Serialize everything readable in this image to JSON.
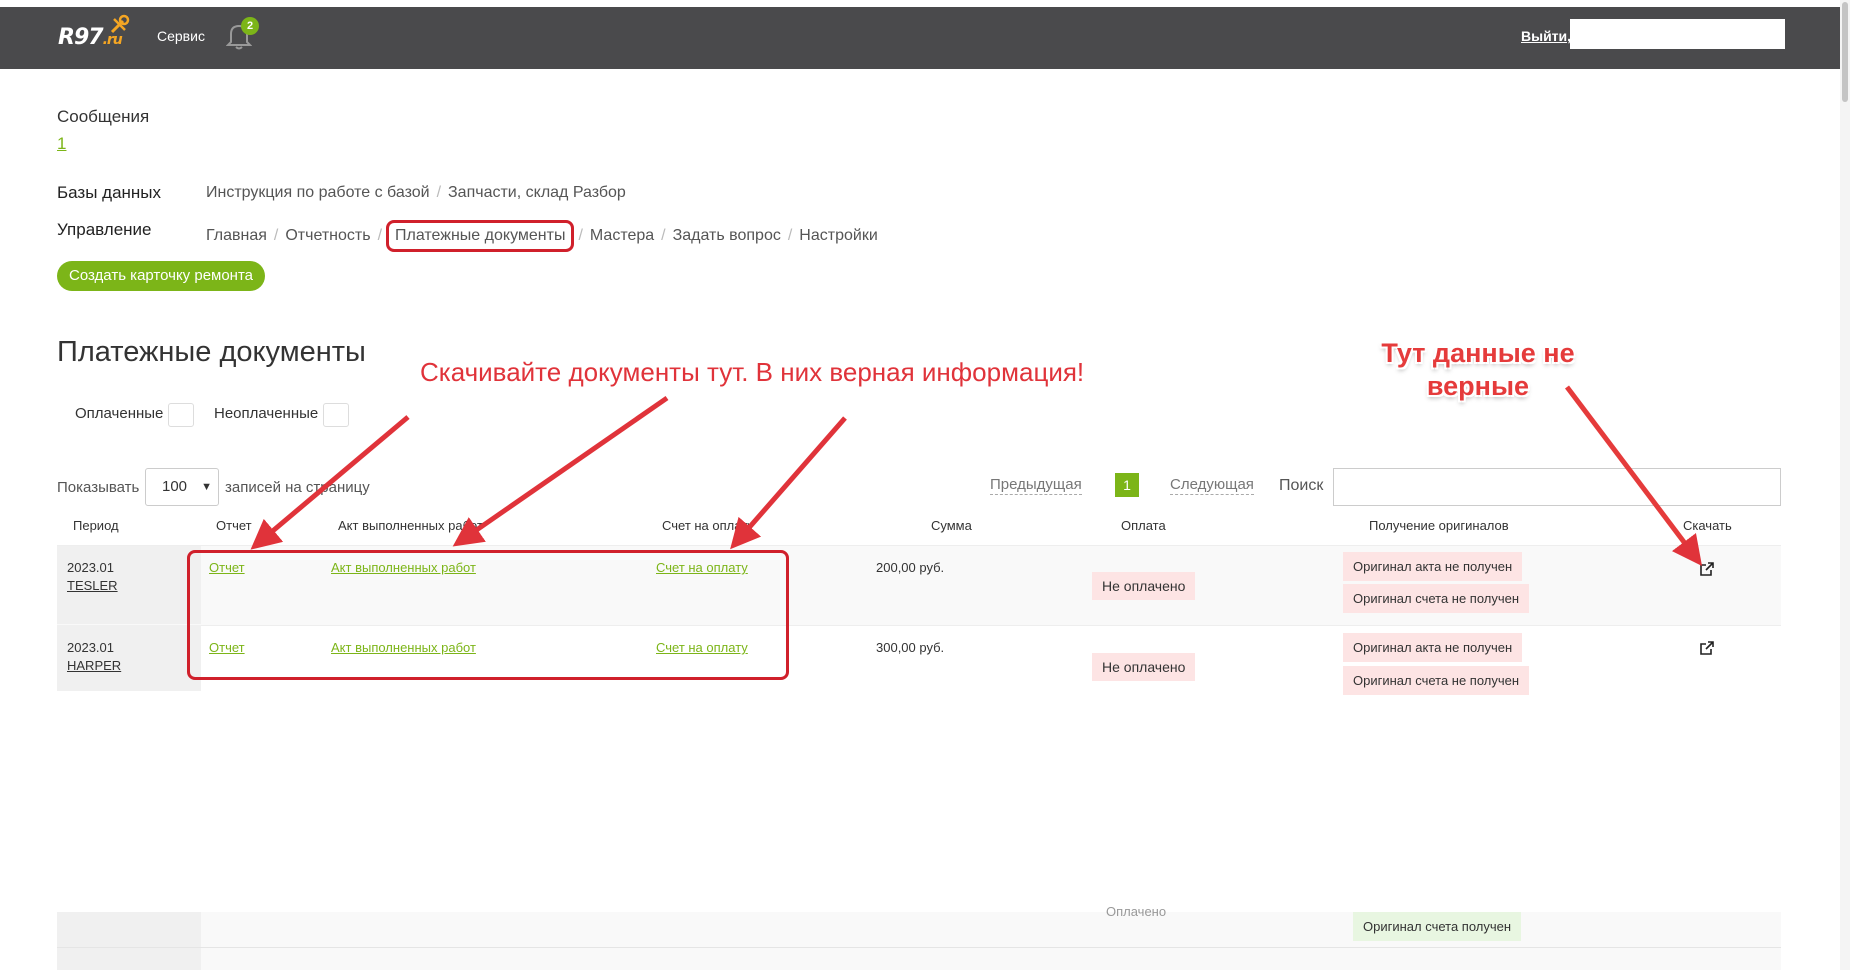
{
  "header": {
    "logo_text": "R97",
    "logo_accent": ".ru",
    "service_label": "Сервис",
    "notifications_count": "2",
    "logout_label": "Выйти,"
  },
  "messages": {
    "title": "Сообщения",
    "count": "1"
  },
  "databases": {
    "label": "Базы данных",
    "items": [
      "Инструкция по работе с базой",
      "Запчасти, склад Разбор"
    ]
  },
  "management": {
    "label": "Управление",
    "items": [
      "Главная",
      "Отчетность",
      "Платежные документы",
      "Мастера",
      "Задать вопрос",
      "Настройки"
    ]
  },
  "create_button": "Создать карточку ремонта",
  "page_title": "Платежные документы",
  "filters": {
    "paid": "Оплаченные",
    "unpaid": "Неоплаченные"
  },
  "table_controls": {
    "show_label": "Показывать",
    "per_page_value": "100",
    "per_page_suffix": "записей на страницу",
    "prev": "Предыдущая",
    "current_page": "1",
    "next": "Следующая",
    "search_label": "Поиск"
  },
  "columns": [
    "Период",
    "Отчет",
    "Акт выполненных работ",
    "Счет на оплату",
    "Сумма",
    "Оплата",
    "Получение оригиналов",
    "Скачать"
  ],
  "rows": [
    {
      "period": "2023.01",
      "master": "TESLER",
      "report": "Отчет",
      "act": "Акт выполненных работ",
      "invoice": "Счет на оплату",
      "sum": "200,00 руб.",
      "payment": "Не оплачено",
      "orig_act": "Оригинал акта не получен",
      "orig_invoice": "Оригинал счета не получен"
    },
    {
      "period": "2023.01",
      "master": "HARPER",
      "report": "Отчет",
      "act": "Акт выполненных работ",
      "invoice": "Счет на оплату",
      "sum": "300,00 руб.",
      "payment": "Не оплачено",
      "orig_act": "Оригинал акта не получен",
      "orig_invoice": "Оригинал счета не получен"
    }
  ],
  "partial_rows": {
    "payment": "Оплачено",
    "orig_invoice": "Оригинал счета получен"
  },
  "annotations": {
    "download_here": "Скачивайте документы тут. В них верная информация!",
    "wrong_data_line1": "Тут данные не",
    "wrong_data_line2": "верные"
  },
  "colors": {
    "accent": "#7cb518",
    "header_bg": "#4a4a4c",
    "annotation_red": "#e0333a"
  }
}
